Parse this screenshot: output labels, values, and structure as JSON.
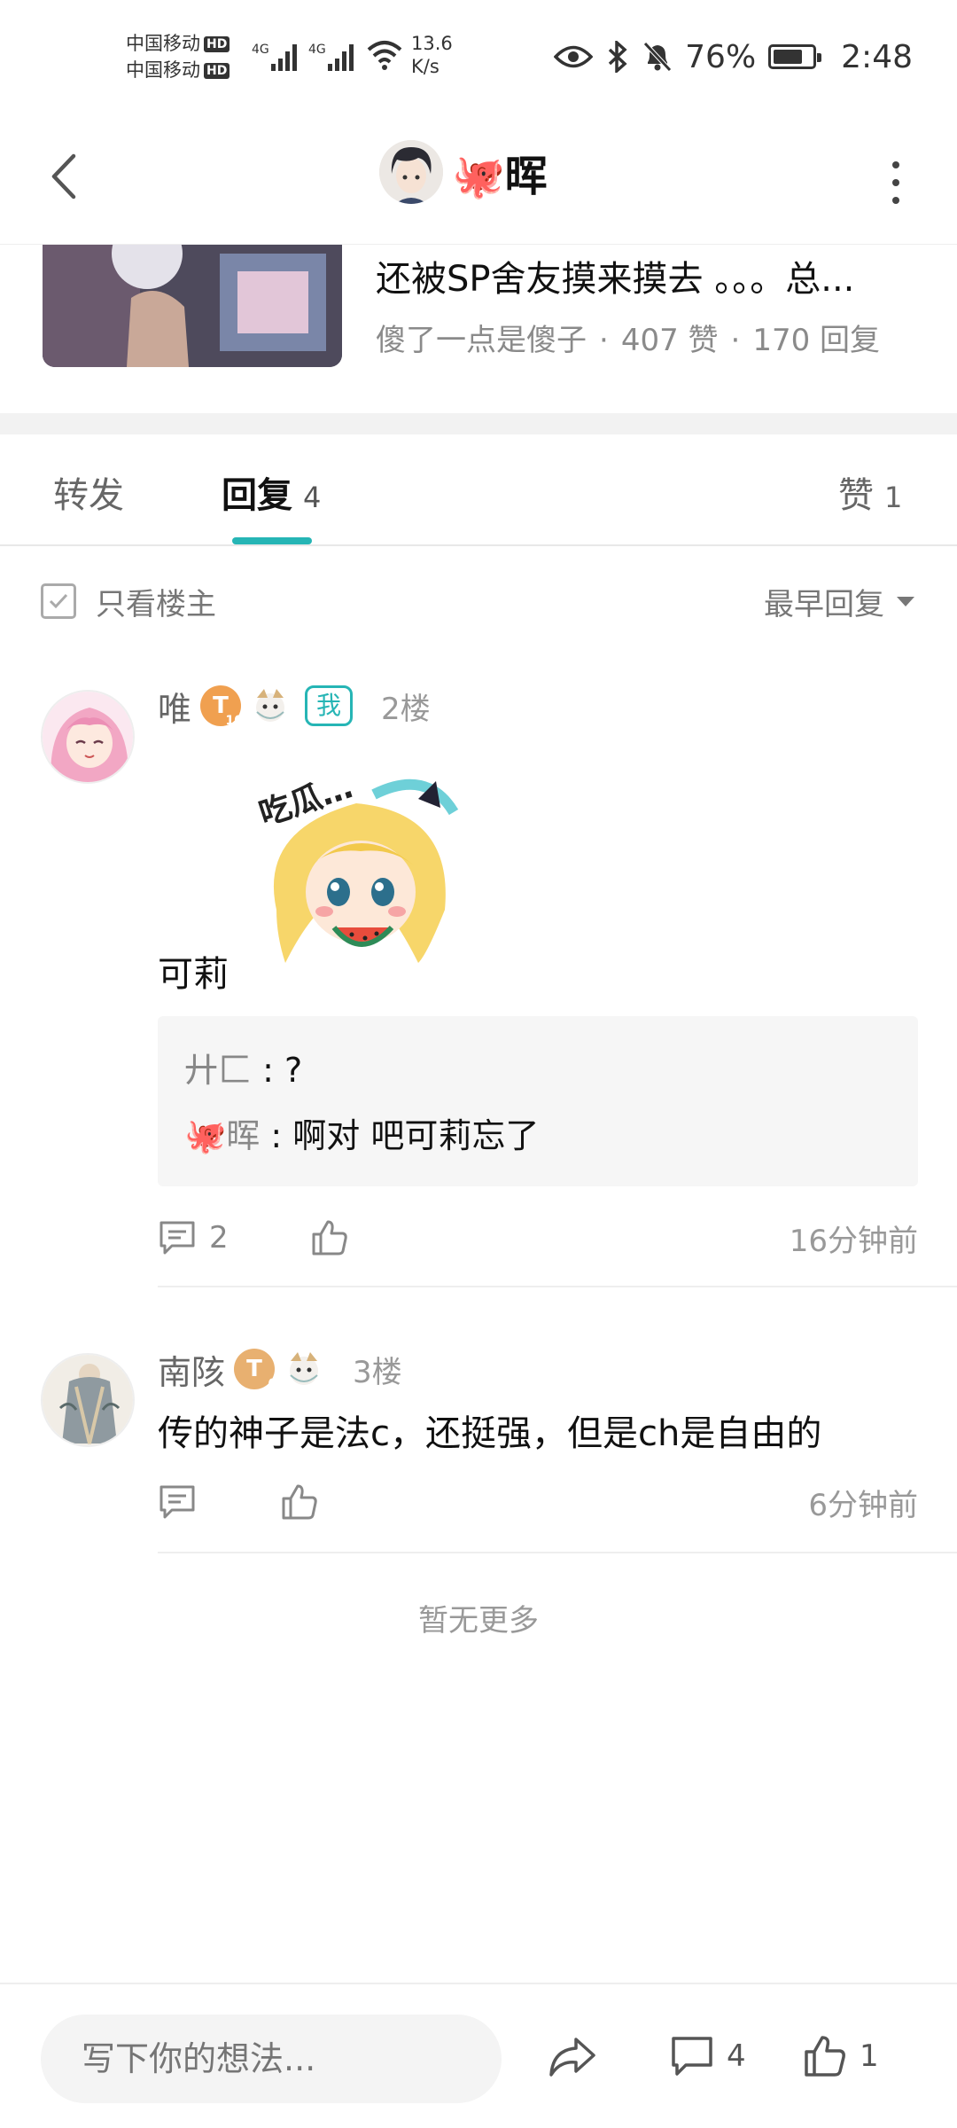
{
  "status_bar": {
    "carrier1": "中国移动",
    "carrier2": "中国移动",
    "hd": "HD",
    "network": "4G",
    "speed_value": "13.6",
    "speed_unit": "K/s",
    "battery": "76%",
    "battery_level": 0.76,
    "time": "2:48"
  },
  "header": {
    "title": "🐙晖"
  },
  "quoted_post": {
    "title": "还被SP舍友摸来摸去 。。。总...",
    "author": "傻了一点是傻子",
    "likes": "407 赞",
    "replies": "170 回复"
  },
  "tabs": {
    "forward": "转发",
    "reply": "回复",
    "reply_count": "4",
    "like": "赞",
    "like_count": "1"
  },
  "filter": {
    "only_op": "只看楼主",
    "sort": "最早回复"
  },
  "comments": [
    {
      "name": "唯",
      "level": "T",
      "level_num": "10",
      "badge": "我",
      "floor": "2楼",
      "text": "可莉",
      "sticker_text": "吃瓜…",
      "sub_replies": [
        {
          "who": "廾匚",
          "text": "?"
        },
        {
          "who": "🐙晖",
          "text": "啊对 吧可莉忘了"
        }
      ],
      "reply_count": "2",
      "time": "16分钟前"
    },
    {
      "name": "南陔",
      "level": "T",
      "level_num": "6",
      "floor": "3楼",
      "text": "传的神子是法c，还挺强，但是ch是自由的",
      "time": "6分钟前"
    }
  ],
  "no_more": "暂无更多",
  "bottom": {
    "placeholder": "写下你的想法...",
    "comment_count": "4",
    "like_count": "1"
  },
  "colors": {
    "accent": "#26b5b5",
    "level_orange": "#f0a050",
    "level_gold": "#e8b070"
  }
}
